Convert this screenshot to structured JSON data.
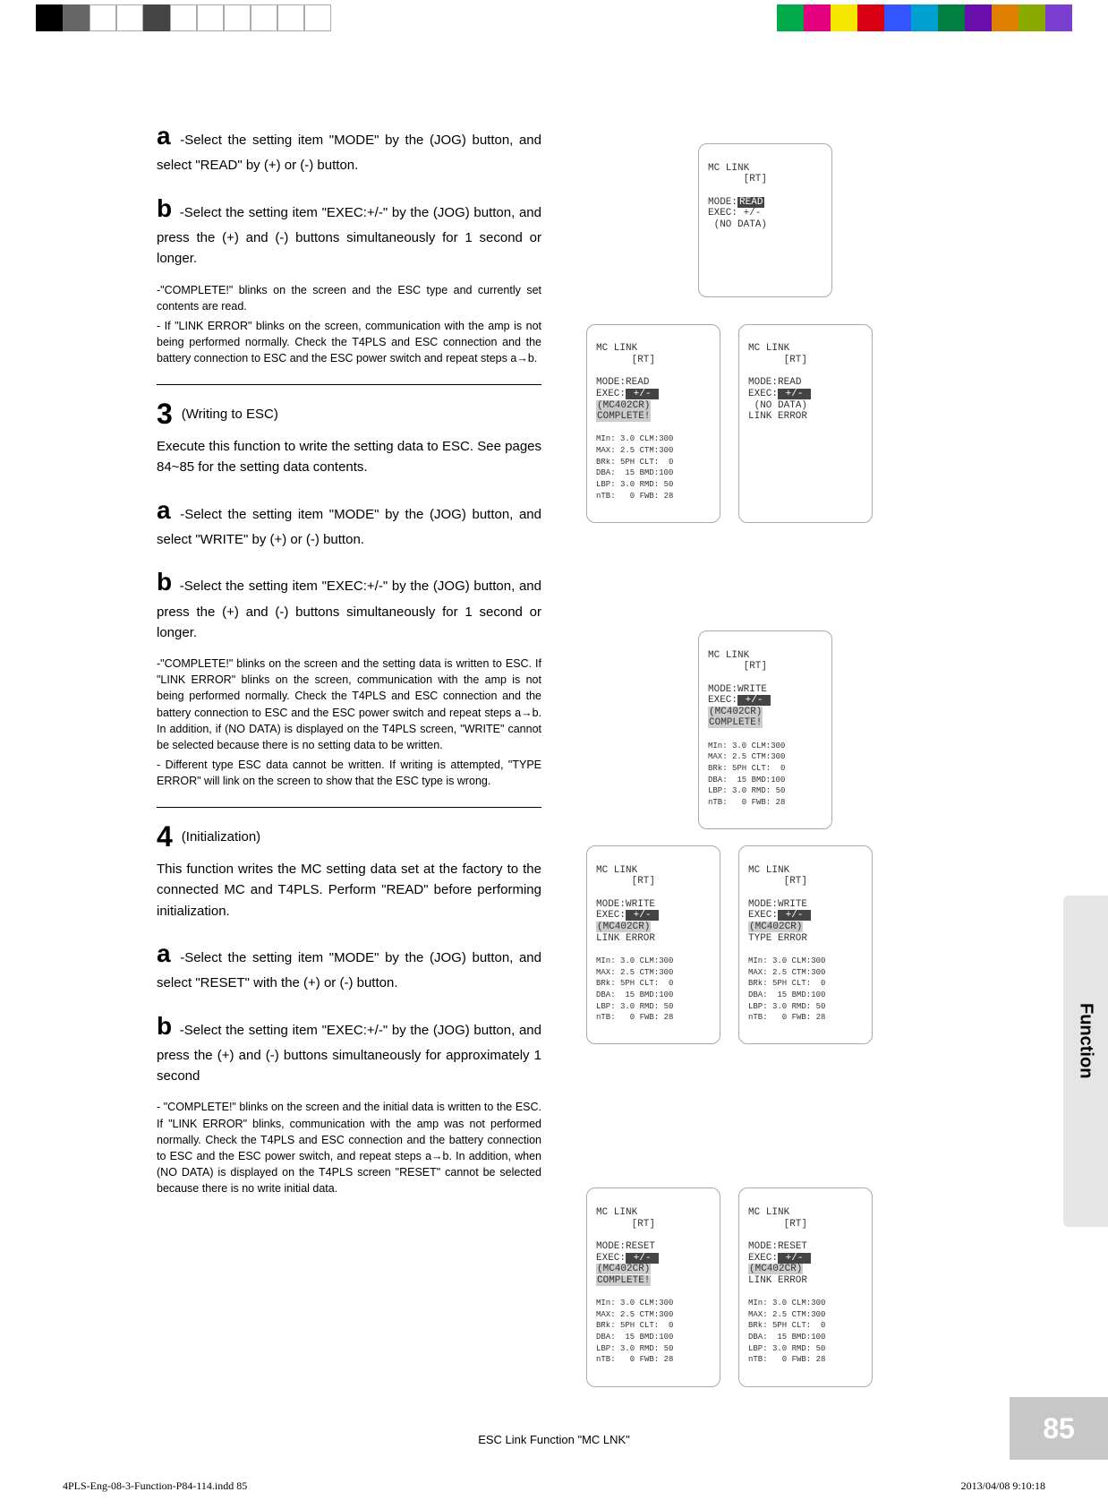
{
  "colorbar": [
    "#000",
    "#666",
    "#fff",
    "#fff",
    "#444",
    "#fff",
    "#fff",
    "#fff",
    "#fff",
    "#fff",
    "#fff"
  ],
  "colorbar2": [
    "#00aa4a",
    "#e4007f",
    "#f5e600",
    "#d80012",
    "#0433ff",
    "#008ce0",
    "#008040",
    "#6a0dad",
    "#e18000",
    "#aaaa00",
    "#8a2be2"
  ],
  "s1_a": "-Select the setting item \"MODE\" by the (JOG) button, and select \"READ\" by (+) or (-) button.",
  "s1_b": "-Select the setting item \"EXEC:+/-\" by the (JOG) button, and press the (+) and (-) buttons simultaneously for 1 second or longer.",
  "s1_note1": "-\"COMPLETE!\" blinks on the screen and the ESC type and currently set contents are read.",
  "s1_note2": "- If \"LINK ERROR\" blinks on the screen, communication with the amp is not being performed normally. Check the T4PLS and ESC connection and the battery connection to ESC and the ESC power switch and repeat steps a→b.",
  "s3_title": "(Writing to ESC)",
  "s3_lead": "Execute this function to write the setting data to ESC. See pages 84~85 for the setting data contents.",
  "s3_a": "-Select the setting item \"MODE\" by the (JOG) button, and select \"WRITE\" by (+) or (-) button.",
  "s3_b": "-Select the setting item \"EXEC:+/-\" by the (JOG) button, and press the (+) and (-) buttons simultaneously for 1 second or longer.",
  "s3_note1": "-\"COMPLETE!\" blinks on the screen and the setting data is written to ESC. If \"LINK ERROR\" blinks on the screen, communication with the amp is not being performed normally. Check the T4PLS and ESC connection and the battery connection to ESC and the ESC power switch and repeat steps a→b. In addition, if (NO DATA) is displayed on the T4PLS screen, \"WRITE\" cannot be selected because there is no setting data to be written.",
  "s3_note2": "- Different type ESC data cannot be written. If writing is attempted, \"TYPE ERROR\" will link on the screen to show that the ESC type is wrong.",
  "s4_title": "(Initialization)",
  "s4_lead": "This function writes the MC setting data set at the factory to the connected MC and T4PLS. Perform \"READ\" before performing initialization.",
  "s4_a": "-Select the setting item \"MODE\" by the (JOG) button, and select \"RESET\" with the (+) or (-) button.",
  "s4_b": "-Select the setting item \"EXEC:+/-\" by the (JOG) button, and press the (+) and (-) buttons simultaneously for approximately 1 second",
  "s4_note1": "- \"COMPLETE!\" blinks on the screen and the initial data is written to the ESC. If \"LINK ERROR\" blinks, communication with the amp was not performed normally. Check the T4PLS and ESC connection and the battery connection to ESC and the ESC power switch, and repeat steps a→b. In addition, when (NO DATA) is displayed on the T4PLS screen \"RESET\" cannot be selected because there is no write initial data.",
  "lcd_header": "MC LINK\n      [RT]",
  "lcd_read_nodata": {
    "mode": "READ",
    "exec": "+/-",
    "extra": "(NO DATA)"
  },
  "lcd_read_complete": {
    "mode": "READ",
    "exec": "+/-",
    "model": "(MC402CR)",
    "status": "COMPLETE!"
  },
  "lcd_read_error": {
    "mode": "READ",
    "exec": "+/-",
    "extra": "(NO DATA)",
    "status": "LINK ERROR"
  },
  "lcd_write_complete": {
    "mode": "WRITE",
    "exec": "+/-",
    "model": "(MC402CR)",
    "status": "COMPLETE!"
  },
  "lcd_write_link": {
    "mode": "WRITE",
    "exec": "+/-",
    "model": "(MC402CR)",
    "status": "LINK ERROR"
  },
  "lcd_write_type": {
    "mode": "WRITE",
    "exec": "+/-",
    "model": "(MC402CR)",
    "status": "TYPE ERROR"
  },
  "lcd_reset_complete": {
    "mode": "RESET",
    "exec": "+/-",
    "model": "(MC402CR)",
    "status": "COMPLETE!"
  },
  "lcd_reset_link": {
    "mode": "RESET",
    "exec": "+/-",
    "model": "(MC402CR)",
    "status": "LINK ERROR"
  },
  "data_block": "MIn: 3.0 CLM:300\nMAX: 2.5 CTM:300\nBRk: 5PH CLT:  0\nDBA:  15 BMD:100\nLBP: 3.0 RMD: 50\nnTB:   0 FWB: 28",
  "sidetab": "Function",
  "pagelabel": "ESC Link Function  \"MC LNK\"",
  "pagenum": "85",
  "printfile": "4PLS-Eng-08-3-Function-P84-114.indd   85",
  "printtime": "2013/04/08   9:10:18"
}
